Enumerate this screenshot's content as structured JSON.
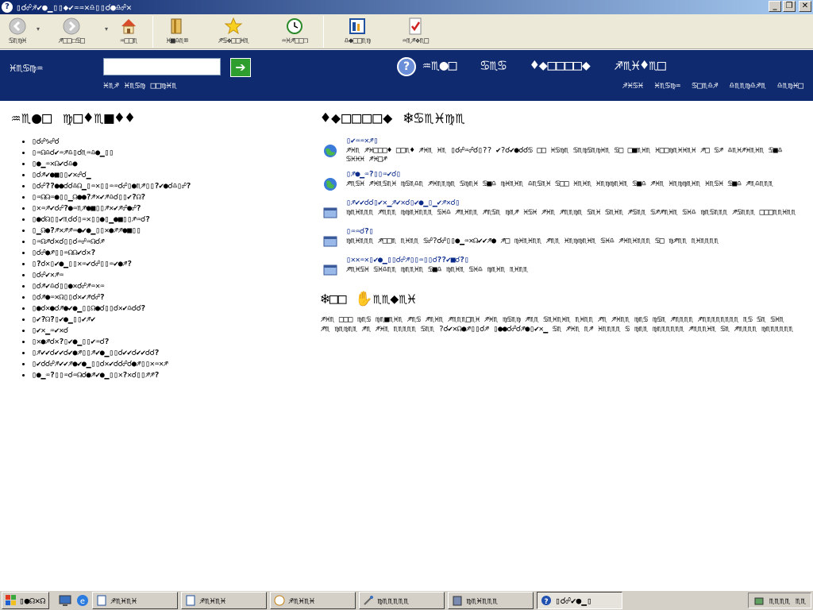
{
  "window": {
    "title": "▯☌☍♐✔●▁▯▯◆✔♒♒✕♎▯▯☌●♎☍✕",
    "buttons": [
      "_",
      "❐",
      "✕"
    ]
  },
  "toolbar": {
    "buttons": [
      {
        "label": "♋♏♍♓",
        "icon": "back-icon"
      },
      {
        "label": "♐□□☐♋□",
        "icon": "forward-icon"
      },
      {
        "label": "♒□□♏",
        "icon": "home-icon"
      },
      {
        "label": "♓■♎♏⌧",
        "icon": "index-icon"
      },
      {
        "label": "♐♋❖□□♓♏",
        "icon": "favorites-icon"
      },
      {
        "label": "♒♓♐□□❒",
        "icon": "history-icon"
      },
      {
        "label": "♎◆□□♏♍",
        "icon": "frames-icon"
      },
      {
        "label": "♒♏♐❖♏□",
        "icon": "checkmark-icon"
      }
    ]
  },
  "nav": {
    "search_label": "♓♏♋♍♒",
    "search_placeholder": "",
    "sub_left": "♓♏♐ ♓♏♋♍ □□♍♓♏",
    "help_symbol": "?",
    "links": [
      "♒♏●□",
      "♋♏♋",
      "♦◆□□□□◆",
      "♐♏♓♦♏□"
    ],
    "sublinks": [
      "♐♓♋♓",
      "♓♏♋♍♒",
      "♋□♏♎♐",
      "♎♏♏♍♎♐♏",
      "♎♏♍♓□"
    ]
  },
  "left": {
    "heading": "♒♏●□ ♍□♦♏■♦♦",
    "topics": [
      "▯☌☍♑☍☌",
      "▯♒☊♎☌✔♒♐♎▯☌♏♒♎●▁▯▯",
      "▯●▁♒✕☊✔☌♎●",
      "▯☌♐✔●■▯▯✔✕☍☌▁",
      "▯☌☍??●●☌☌♎☊▁▯♒✕▯▯♒♒☌☍▯●♏♐▯▯?✔●☌♎▯☍?",
      "▯♒☊☊♒●▯▯▁☊●●?♐✕✔♐♎☌▯▯✔?☊?",
      "▯✕♒♐✔☌☍?●♒♏♐●■▯▯♐✕✔♐☍●☍?",
      "▯●☌☊▯▯✔♏☌☌▯♒✕▯▯●▯▁●■▯▯♐♒☌?",
      "▯▁☊●?♐✕♐♐♒●✔●▁▯▯✕●♐♐●■▯▯",
      "▯♒☊♐☌✕☌▯▯☌♒☍♒☊☌♐",
      "▯☌☍●♐▯▯♒☊☊✔☌✕?",
      "▯?☌✕▯✔●▁▯▯✕♒✔☌☍▯▯♒✔●♐?",
      "▯☌☍✔✕♐♒",
      "▯☌♐✔♎☌▯▯●✕☌☍♐♒✕♒",
      "▯☌♐●♒✕☊▯▯☌✕✔♐☌☍?",
      "▯●☌✕●☌♐●✔●▁▯▯☊●☌▯▯☌✕✔♎☌☌?",
      "▯✔?☊?▯✔●▁▯▯✔♐✔",
      "▯✔✕▁♒✔✕☌",
      "▯✕●♐☌✕?▯✔●▁▯▯✔♒☌?",
      "▯♐✔✔☌✔✔☌✔●♐▯▯♐✔●▁▯▯☌✔✔☌✔✔☌☌?",
      "▯✔☌☌☍♐✔✔♐●✔●▁▯▯☌✕✔☌☌☍☌●♐▯▯✕♒✕♐",
      "▯●▁♒?▯▯♒☌♒☊☌●♐✔●▁▯▯✕?✕☌▯▯♐♐?"
    ]
  },
  "right": {
    "heading": "♦◆□□□□◆ ❄♋♏♓♍♏",
    "items": [
      {
        "icon": "globe-icon",
        "title": "▯✔♒♒✕♐▯",
        "text": "♐♓♏ ♐♓□□□♦ □□♏♦ ♐♓♏ ♓♏ ▯☌☍♒☍☌▯?? ✔?☌✔●☌☌♋ □□ ♓♋♍♏ ♋♏♍♋♏♍♓♏ ♋□ □■♏♓♏ ♓□□♍♏♓♓♏♓ ♐□ ♋♐ ♎♏♓♐♓♏♓♏ ♋■♎ ♋♓♓♓ ♐♓□♐"
      },
      {
        "icon": "globe-icon",
        "title": "▯♐●▁♒?▯▯♒✔☌▯",
        "text": "♐♏♋♓ ♐♓♏♋♏♓ ♍♋♏♎♏ ♐♓♏♏♍♏ ♋♍♏♓ ♋■♎ ♍♓♏♓♏ ♎♏♋♏♓ ♋□□ ♓♏♓♏ ♓♏♍♍♏♓♏ ♋■♎ ♐♓♏ ♓♏♍♍♏♓♏ ♓♏♋♓ ♋■♎ ♐♏♎♏♏♏"
      },
      {
        "icon": "window-icon",
        "title": "▯♐✔✔☌☌▯✔✕▁♐✔✕☌▯✔●▁▯▁✔♐✕☌▯",
        "text": "♍♏♓♏♏♏ ♐♏♏♏ ♍♍♏♓♏♏♏ ♋♓♎ ♐♏♓♏♏ ♐♏♋♏ ♍♏♐ ♓♋♓ ♐♓♏ ♐♏♏♍♏ ♋♏♓ ♋♏♓♏ ♐♋♏♏ ♋♐♐♏♓♏ ♋♓♎ ♍♏♋♏♏♏ ♐♋♏♏♏ □□□♏♏♓♏♏"
      },
      {
        "icon": "window-icon",
        "title": "▯♒♒☌?▯",
        "text": "♍♏♓♏♏♏ ♐□□♏ ♏♓♏♏ ♋☍?☌☍▯▯●▁♒✕☊✔✔♐● ♐□ ♍♓♏♓♏♏ ♐♏♏ ♓♏♍♍♏♓♏ ♋♓♎ ♐♓♏♓♏♏♏ ♋□ ♍♐♏♏ ♏♓♏♏♏♏"
      },
      {
        "icon": "window-icon",
        "title": "▯✕✕♒✕▯✔●▁▯▯☌☍♐▯▯♒▯▯☌??✔■☌?▯",
        "text": "♐♏♓♋♓ ♋♓♎♏♏ ♍♏♏♓♏ ♋■♎ ♍♏♓♏ ♋♓♎ ♍♏♓♏ ♏♓♏♏"
      }
    ],
    "note_title": "❄□□ ✋♏♏◆♏♓",
    "note_text": "♐♓♏ □□□ ♍♏♋ ♍♏■♏♓♏ ♐♏♋ ♐♏♓♏ ♐♏♏♏□♏♓ ♐♓♏ ♍♋♏♍ ♐♏♏ ♋♏♓♏♓♏ ♏♓♏♏ ♐♏ ♐♓♏♏ ♍♏♋ ♍♋♏ ♐♏♏♏♏ ♐♏♏♏♏♏♏♏♏ ♏♋ ♋♏ ♋♓♏ ♐♏ ♍♏♍♏♏ ♐♏ ♐♓♏ ♏♏♏♏♏ ♋♏♏ ?☌✔✕☊●♐▯▯☌♐ ▯●●☌☍☌♐●▯✔✕▁ ♋♏ ♐♓♏ ♏♐ ♓♏♏♏♏ ♋ ♍♏♏ ♍♏♏♏♏♏♏ ♐♏♏♏♓♏ ♋♏ ♐♏♏♏♏ ♍♏♏♏♏♏♏"
  },
  "taskbar": {
    "start_label": "▯●☊✕☊",
    "tasks": [
      {
        "label": "♐♏♓♏♓",
        "icon": "doc-icon",
        "active": false
      },
      {
        "label": "♐♏♓♏♓",
        "icon": "doc-icon",
        "active": false
      },
      {
        "label": "♐♏♓♏♓",
        "icon": "clock-icon",
        "active": false
      },
      {
        "label": "♍♏♏♏♏♏",
        "icon": "tools-icon",
        "active": false
      },
      {
        "label": "♍♏♓♏♏♏",
        "icon": "book-icon",
        "active": false
      },
      {
        "label": "▯☌☍✔●▁▯",
        "icon": "help-icon",
        "active": true
      }
    ],
    "tray_text": "♏♏♏♏ ♏♏"
  }
}
